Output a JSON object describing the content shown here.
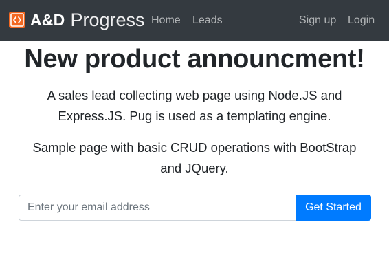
{
  "navbar": {
    "brand": {
      "icon": "code-brackets-icon",
      "strong_text": "A&D",
      "light_text": "Progress"
    },
    "links": {
      "home": "Home",
      "leads": "Leads",
      "signup": "Sign up",
      "login": "Login"
    }
  },
  "main": {
    "title": "New product announcment!",
    "lead_1": "A sales lead collecting web page using Node.JS and Express.JS. Pug is used as a templating engine.",
    "lead_2": "Sample page with basic CRUD operations with BootStrap and JQuery."
  },
  "signup_form": {
    "email_placeholder": "Enter your email address",
    "email_value": "",
    "button_label": "Get Started"
  },
  "colors": {
    "navbar_bg": "#343a40",
    "brand_icon": "#f26822",
    "primary": "#007bff",
    "text": "#212529"
  }
}
